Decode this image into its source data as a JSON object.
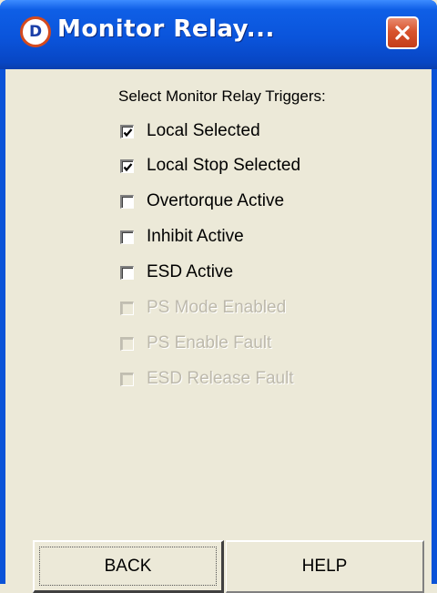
{
  "window": {
    "title": "Monitor Relay...",
    "app_icon_letter": "D",
    "title_bar_color": "#0A54DB",
    "close_button_color": "#D8542E"
  },
  "triggers": {
    "heading": "Select Monitor Relay Triggers:",
    "options": [
      {
        "label": "Local Selected",
        "checked": true,
        "enabled": true
      },
      {
        "label": "Local Stop Selected",
        "checked": true,
        "enabled": true
      },
      {
        "label": "Overtorque Active",
        "checked": false,
        "enabled": true
      },
      {
        "label": "Inhibit Active",
        "checked": false,
        "enabled": true
      },
      {
        "label": "ESD Active",
        "checked": false,
        "enabled": true
      },
      {
        "label": "PS Mode Enabled",
        "checked": false,
        "enabled": false
      },
      {
        "label": "PS Enable Fault",
        "checked": false,
        "enabled": false
      },
      {
        "label": "ESD Release Fault",
        "checked": false,
        "enabled": false
      }
    ]
  },
  "buttons": {
    "back": "BACK",
    "help": "HELP"
  }
}
